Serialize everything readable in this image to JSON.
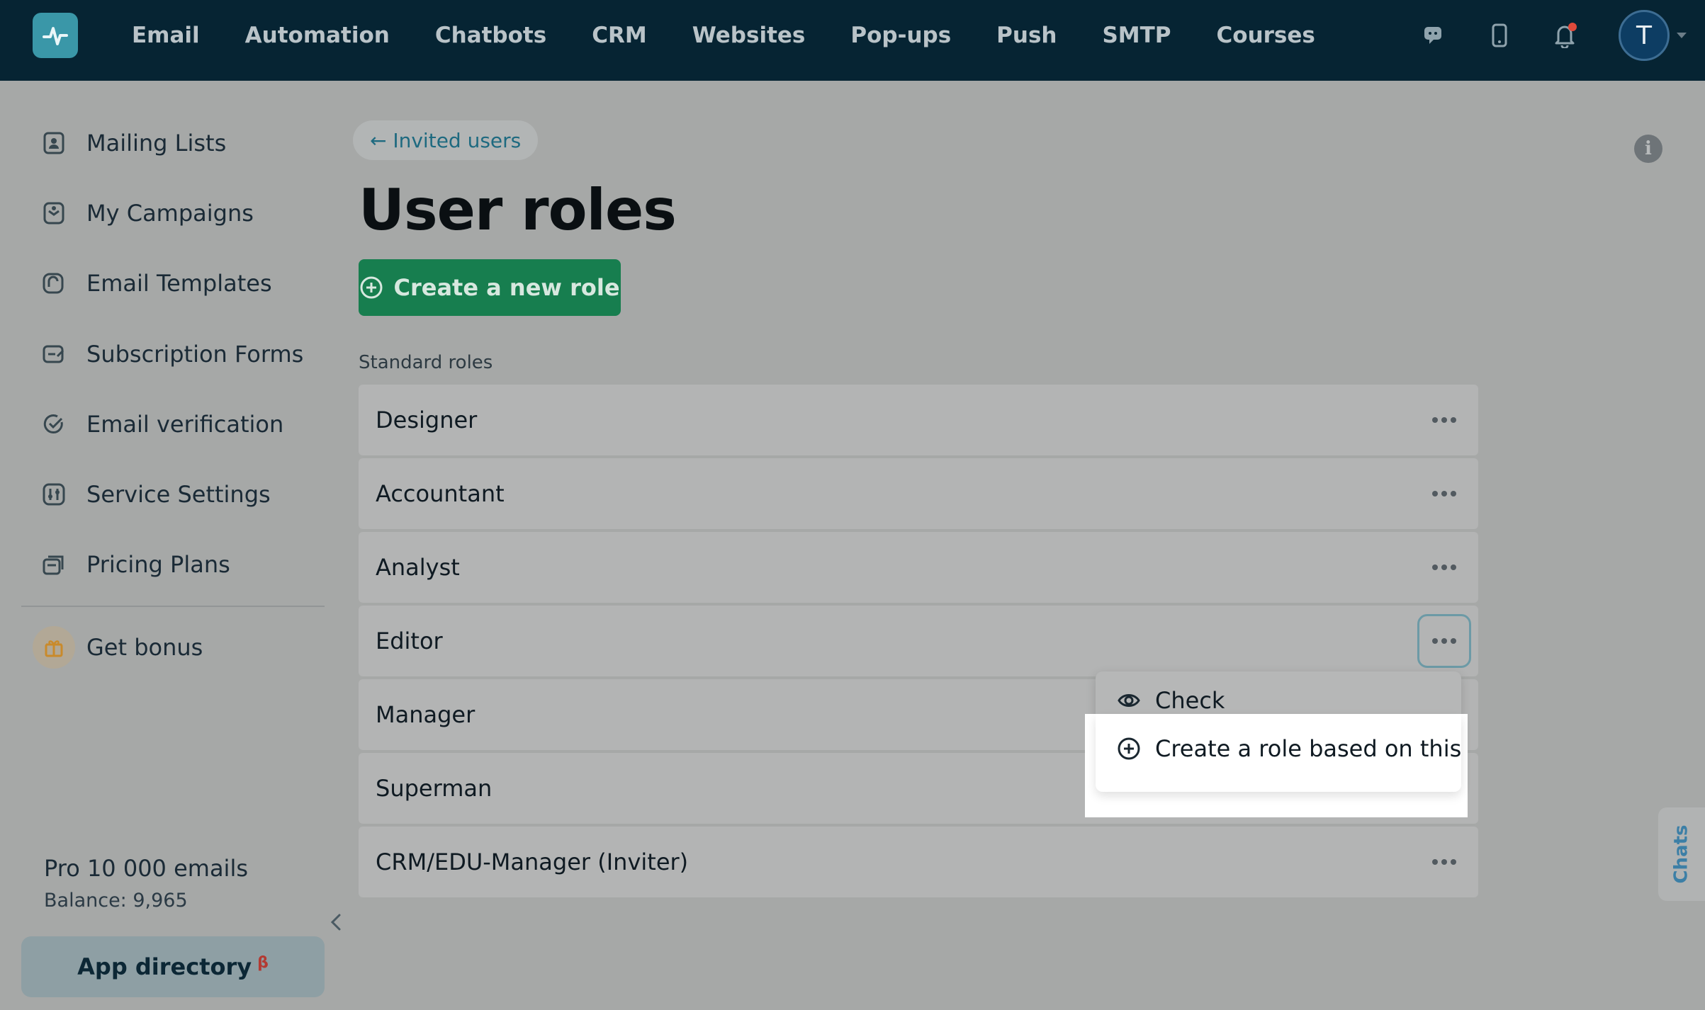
{
  "topnav": {
    "items": [
      "Email",
      "Automation",
      "Chatbots",
      "CRM",
      "Websites",
      "Pop-ups",
      "Push",
      "SMTP",
      "Courses"
    ],
    "avatar_letter": "T",
    "notification_color": "#e04a3b"
  },
  "sidebar": {
    "items": [
      {
        "label": "Mailing Lists",
        "icon": "contacts-icon"
      },
      {
        "label": "My Campaigns",
        "icon": "campaigns-icon"
      },
      {
        "label": "Email Templates",
        "icon": "templates-icon"
      },
      {
        "label": "Subscription Forms",
        "icon": "forms-icon"
      },
      {
        "label": "Email verification",
        "icon": "check-circle-icon"
      },
      {
        "label": "Service Settings",
        "icon": "settings-icon"
      },
      {
        "label": "Pricing Plans",
        "icon": "pricing-icon"
      }
    ],
    "bonus_label": "Get bonus",
    "plan_name": "Pro 10 000 emails",
    "balance": "Balance: 9,965",
    "app_directory": "App directory",
    "app_directory_badge": "β"
  },
  "main": {
    "back_link": "← Invited users",
    "title": "User roles",
    "create_button": "Create a new role",
    "section_label": "Standard roles",
    "roles": [
      "Designer",
      "Accountant",
      "Analyst",
      "Editor",
      "Manager",
      "Superman",
      "CRM/EDU-Manager (Inviter)"
    ],
    "active_role": "Editor"
  },
  "dropdown": {
    "check": "Check",
    "create_based": "Create a role based on this"
  },
  "chats_tab": "Chats",
  "colors": {
    "nav_bg": "#062433",
    "primary_button": "#177e4f",
    "link": "#1e6a80"
  }
}
